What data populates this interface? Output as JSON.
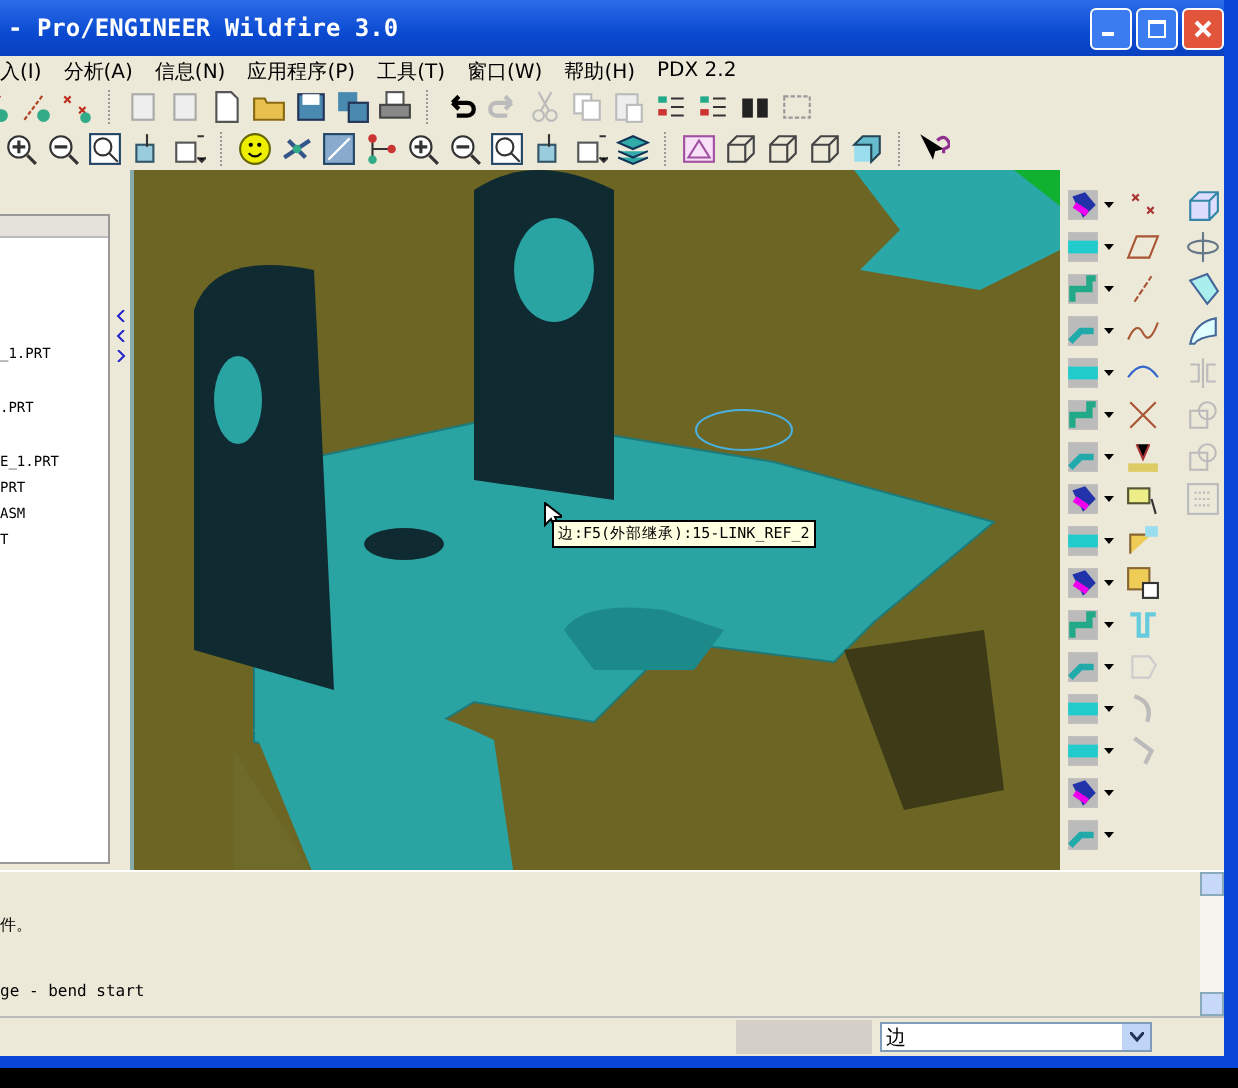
{
  "window": {
    "title": "- Pro/ENGINEER Wildfire 3.0"
  },
  "menu": [
    {
      "label": "入(I)"
    },
    {
      "label": "分析(A)"
    },
    {
      "label": "信息(N)"
    },
    {
      "label": "应用程序(P)"
    },
    {
      "label": "工具(T)"
    },
    {
      "label": "窗口(W)"
    },
    {
      "label": "帮助(H)"
    },
    {
      "label": "PDX 2.2"
    }
  ],
  "model_tree": {
    "items": [
      "_1.PRT",
      ".PRT",
      "E_1.PRT",
      "PRT",
      "ASM",
      "T"
    ]
  },
  "tooltip": "边:F5(外部继承):15-LINK_REF_2",
  "messages": [
    "件。",
    "ge - bend start"
  ],
  "status_bar": {
    "filter": "边"
  }
}
